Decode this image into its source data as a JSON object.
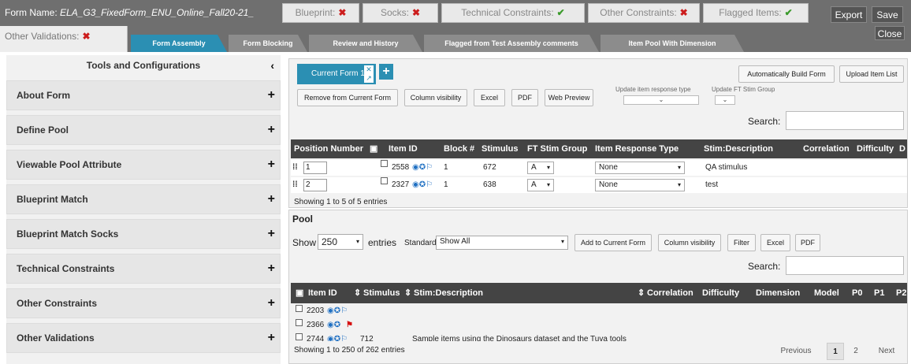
{
  "header": {
    "form_name_label": "Form Name:",
    "form_name_value": "ELA_G3_FixedForm_ENU_Online_Fall20-21_",
    "status_tabs": [
      {
        "label": "Blueprint:",
        "state": "✖"
      },
      {
        "label": "Socks:",
        "state": "✖"
      },
      {
        "label": "Technical Constraints:",
        "state": "✔"
      },
      {
        "label": "Other Constraints:",
        "state": "✖"
      },
      {
        "label": "Flagged Items:",
        "state": "✔"
      }
    ],
    "export_label": "Export",
    "save_label": "Save",
    "close_label": "Close",
    "other_validations_label": "Other Validations:",
    "other_validations_state": "✖"
  },
  "nav_tabs": [
    {
      "label": "Form Assembly"
    },
    {
      "label": "Form Blocking"
    },
    {
      "label": "Review and History"
    },
    {
      "label": "Flagged from Test Assembly comments"
    },
    {
      "label": "Item Pool With Dimension"
    }
  ],
  "sidebar": {
    "title": "Tools and Configurations",
    "collapse_icon": "chevron-left-icon",
    "items": [
      {
        "label": "About Form"
      },
      {
        "label": "Define Pool"
      },
      {
        "label": "Viewable Pool Attribute"
      },
      {
        "label": "Blueprint Match"
      },
      {
        "label": "Blueprint Match Socks"
      },
      {
        "label": "Technical Constraints"
      },
      {
        "label": "Other Constraints"
      },
      {
        "label": "Other Validations"
      }
    ]
  },
  "form_panel": {
    "tab_label": "Current Form 1",
    "add_tab": "+",
    "auto_build_label": "Automatically Build Form",
    "upload_label": "Upload Item List",
    "buttons": {
      "remove": "Remove from Current Form",
      "column_visibility": "Column visibility",
      "excel": "Excel",
      "pdf": "PDF",
      "web_preview": "Web Preview"
    },
    "update_response_label": "Update item response type",
    "update_stim_label": "Update FT Stim Group",
    "search_label": "Search:",
    "columns": [
      "Position Number",
      "Item ID",
      "Block #",
      "Stimulus",
      "FT Stim Group",
      "Item Response Type",
      "Stim:Description",
      "Correlation",
      "Difficulty",
      "D"
    ],
    "rows": [
      {
        "position": "1",
        "item_id": "2558",
        "block": "1",
        "stimulus": "672",
        "ft_group": "A",
        "response": "None",
        "description": "QA stimulus"
      },
      {
        "position": "2",
        "item_id": "2327",
        "block": "1",
        "stimulus": "638",
        "ft_group": "A",
        "response": "None",
        "description": "test"
      }
    ],
    "info": "Showing 1 to 5 of 5 entries"
  },
  "pool_panel": {
    "title": "Pool",
    "show_label": "Show",
    "show_value": "250",
    "entries_label": "entries",
    "standard_label": "Standard",
    "standard_value": "Show All",
    "buttons": {
      "add": "Add to Current Form",
      "column_visibility": "Column visibility",
      "filter": "Filter",
      "excel": "Excel",
      "pdf": "PDF"
    },
    "search_label": "Search:",
    "columns": [
      "Item ID",
      "Stimulus",
      "Stim:Description",
      "Correlation",
      "Difficulty",
      "Dimension",
      "Model",
      "P0",
      "P1",
      "P2"
    ],
    "rows": [
      {
        "item_id": "2203",
        "stimulus": "",
        "description": ""
      },
      {
        "item_id": "2366",
        "stimulus": "",
        "description": ""
      },
      {
        "item_id": "2744",
        "stimulus": "712",
        "description": "Sample items using the Dinosaurs dataset and the Tuva tools"
      }
    ],
    "info": "Showing 1 to 250 of 262 entries",
    "pager": {
      "previous": "Previous",
      "page1": "1",
      "page2": "2",
      "next": "Next"
    }
  }
}
